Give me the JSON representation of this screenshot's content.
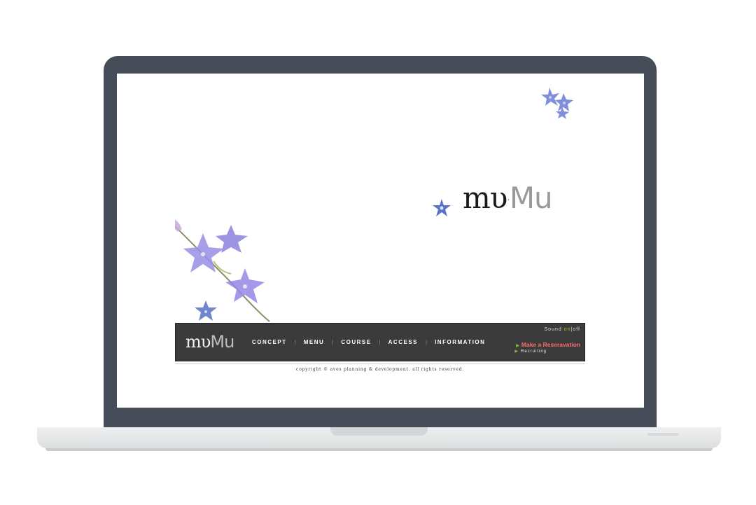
{
  "site": {
    "logo_primary": "mυ",
    "logo_sep": "·",
    "logo_secondary": "Mu"
  },
  "nav": {
    "items": [
      {
        "label": "CONCEPT"
      },
      {
        "label": "MENU"
      },
      {
        "label": "COURSE"
      },
      {
        "label": "ACCESS"
      },
      {
        "label": "INFORMATION"
      }
    ],
    "separator": "|"
  },
  "sound": {
    "label": "Sound",
    "on": "on",
    "divider": "|",
    "off": "off"
  },
  "reservation": {
    "label": "Make a Reseravation",
    "recruit": "Recruiting"
  },
  "footer": {
    "copyright": "copyright © aves planning & development. all rights reserved."
  },
  "colors": {
    "navbar": "#3b3b3b",
    "reservation_text": "#ff6b6b",
    "sound_on": "#c8b820",
    "arrow": "#7bbf3a",
    "laptop_frame": "#474d58"
  },
  "icons": [
    "bellflower-decoration-icon",
    "arrow-right-icon"
  ]
}
